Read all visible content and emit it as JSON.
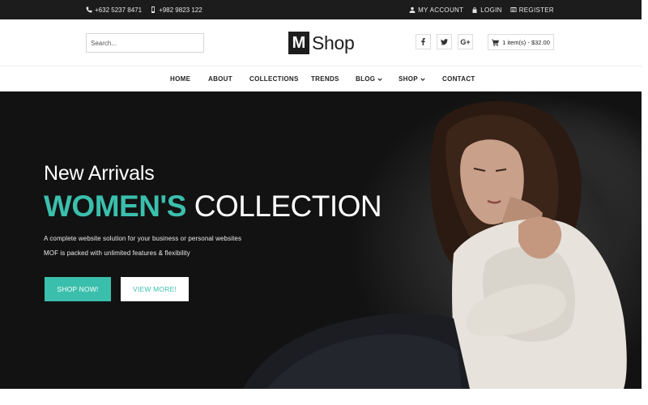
{
  "topbar": {
    "phone": "+632 5237 8471",
    "mobile": "+982 9823 122",
    "my_account": "MY ACCOUNT",
    "login": "LOGIN",
    "register": "REGISTER"
  },
  "header": {
    "search_placeholder": "Search...",
    "logo_mark": "M",
    "logo_text": "Shop",
    "social": [
      "facebook",
      "twitter",
      "google-plus"
    ],
    "google_plus_label": "G+",
    "cart_label": "1 item(s) - $32.00"
  },
  "nav": {
    "items": [
      {
        "label": "HOME"
      },
      {
        "label": "ABOUT"
      },
      {
        "label": "COLLECTIONS"
      },
      {
        "label": "TRENDS"
      },
      {
        "label": "BLOG"
      },
      {
        "label": "SHOP"
      },
      {
        "label": "CONTACT"
      }
    ]
  },
  "hero": {
    "kicker": "New Arrivals",
    "title_accent": "WOMEN'S",
    "title_rest": "COLLECTION",
    "desc_line1": "A complete website solution for your business or personal websites",
    "desc_line2": "MOF is packed with unlimited features & flexibility",
    "shop_button": "SHOP NOW!",
    "more_button": "VIEW MORE!"
  },
  "colors": {
    "accent": "#3bbfad",
    "topbar_bg": "#1c1c1c",
    "hero_bg": "#121212"
  },
  "icons": [
    "phone-icon",
    "mobile-icon",
    "user-icon",
    "lock-icon",
    "register-icon",
    "facebook-icon",
    "twitter-icon",
    "google-plus-icon",
    "cart-icon",
    "chevron-down-icon"
  ]
}
